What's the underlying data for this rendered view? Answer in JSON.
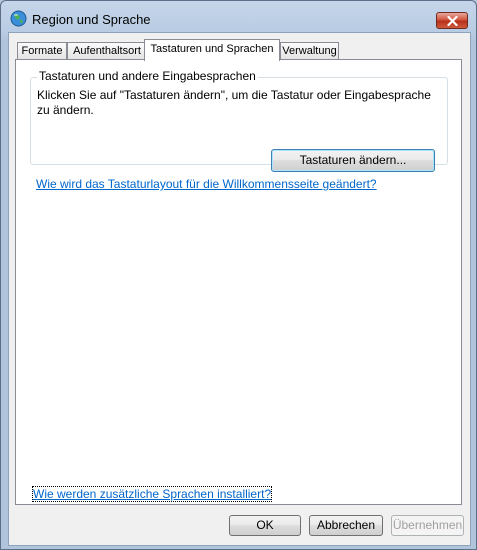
{
  "window": {
    "title": "Region und Sprache",
    "icons": {
      "app": "globe-icon",
      "close": "close-icon"
    }
  },
  "tabs": [
    {
      "label": "Formate",
      "active": false
    },
    {
      "label": "Aufenthaltsort",
      "active": false
    },
    {
      "label": "Tastaturen und Sprachen",
      "active": true
    },
    {
      "label": "Verwaltung",
      "active": false
    }
  ],
  "panel": {
    "group_title": "Tastaturen und andere Eingabesprachen",
    "group_description": "Klicken Sie auf \"Tastaturen ändern\", um die Tastatur oder Eingabesprache zu ändern.",
    "change_keyboards_button": "Tastaturen ändern...",
    "welcome_layout_link": "Wie wird das Tastaturlayout für die Willkommensseite geändert?",
    "install_languages_link": "Wie werden zusätzliche Sprachen installiert?"
  },
  "footer": {
    "ok_label": "OK",
    "cancel_label": "Abbrechen",
    "apply_label": "Übernehmen",
    "apply_enabled": false
  },
  "colors": {
    "link": "#0066cc",
    "close_button": "#c9432b",
    "window_frame": "#b9cce3"
  }
}
